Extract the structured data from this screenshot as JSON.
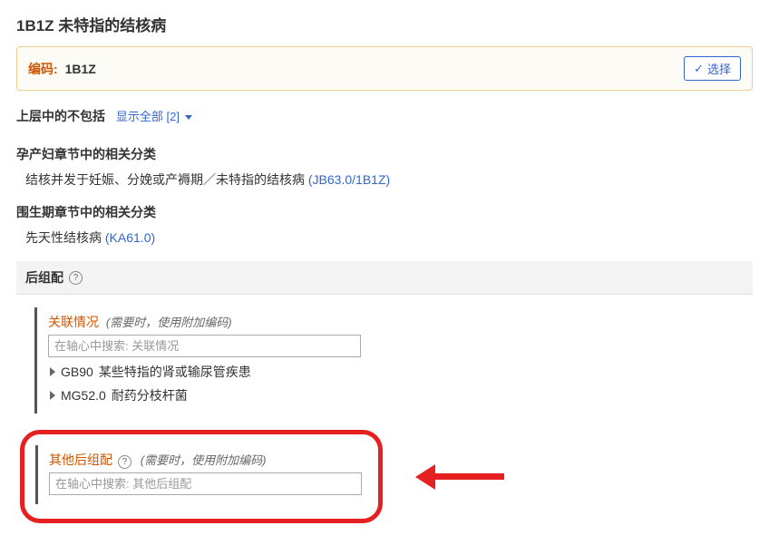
{
  "page_title": "1B1Z 未特指的结核病",
  "code_box": {
    "label": "编码:",
    "value": "1B1Z",
    "select_button": "选择"
  },
  "excludes": {
    "title": "上层中的不包括",
    "show_all": "显示全部 [2]"
  },
  "maternal": {
    "title": "孕产妇章节中的相关分类",
    "item_text": "结核并发于妊娠、分娩或产褥期／未特指的结核病",
    "item_code": "(JB63.0/1B1Z)"
  },
  "perinatal": {
    "title": "围生期章节中的相关分类",
    "item_text": "先天性结核病",
    "item_code": "(KA61.0)"
  },
  "postcoord": {
    "header": "后组配",
    "axis1": {
      "label": "关联情况",
      "note": "(需要时，使用附加编码)",
      "placeholder": "在轴心中搜索: 关联情况",
      "items": [
        {
          "code": "GB90",
          "text": "某些特指的肾或输尿管疾患"
        },
        {
          "code": "MG52.0",
          "text": "耐药分枝杆菌"
        }
      ]
    },
    "axis2": {
      "label": "其他后组配",
      "note": "(需要时，使用附加编码)",
      "placeholder": "在轴心中搜索: 其他后组配"
    }
  }
}
